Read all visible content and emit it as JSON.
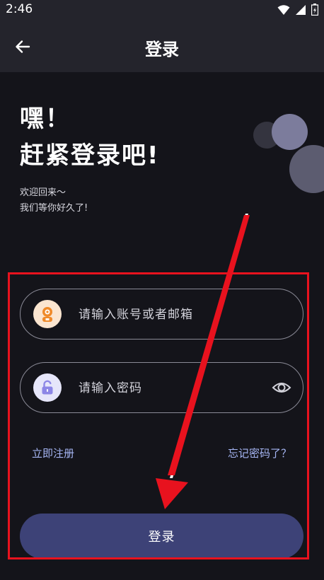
{
  "status_bar": {
    "time": "2:46"
  },
  "header": {
    "title": "登录"
  },
  "greeting": {
    "line1": "嘿！",
    "line2": "赶紧登录吧!",
    "welcome1": "欢迎回来～",
    "welcome2": "我们等你好久了!"
  },
  "form": {
    "account_placeholder": "请输入账号或者邮箱",
    "password_placeholder": "请输入密码",
    "register_label": "立即注册",
    "forgot_label": "忘记密码了？",
    "login_label": "登录"
  },
  "colors": {
    "background": "#14141a",
    "header": "#24242c",
    "accent": "#3d4277",
    "link": "#a6b6f4",
    "highlight": "#e8121e"
  }
}
